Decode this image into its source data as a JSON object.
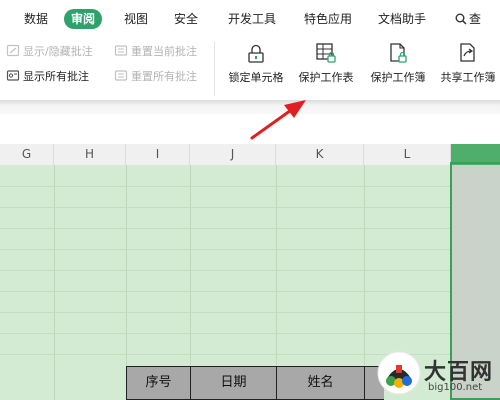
{
  "menu": {
    "tabs": [
      {
        "label": "数据"
      },
      {
        "label": "审阅",
        "active": true
      },
      {
        "label": "视图"
      },
      {
        "label": "安全"
      },
      {
        "label": "开发工具"
      },
      {
        "label": "特色应用"
      },
      {
        "label": "文档助手"
      }
    ],
    "search_label": "查"
  },
  "ribbon": {
    "show_hide_comments": "显示/隐藏批注",
    "show_all_comments": "显示所有批注",
    "reset_current_comment": "重置当前批注",
    "reset_all_comments": "重置所有批注",
    "lock_cells": "锁定单元格",
    "protect_sheet": "保护工作表",
    "protect_workbook": "保护工作簿",
    "share_workbook": "共享工作簿"
  },
  "sheet": {
    "columns": [
      "G",
      "H",
      "I",
      "J",
      "K",
      "L",
      "M"
    ],
    "selected_column": "M",
    "table_headers": [
      "序号",
      "日期",
      "姓名"
    ]
  },
  "watermark": {
    "title": "大百网",
    "url": "big100.net"
  },
  "colors": {
    "accent": "#2fa16a",
    "grid_fill": "#d3ebd3",
    "arrow": "#e02020"
  }
}
